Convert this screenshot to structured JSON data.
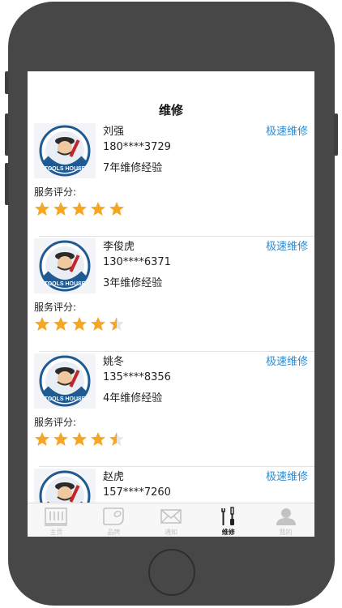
{
  "header": {
    "title": "维修"
  },
  "workers": [
    {
      "name": "刘强",
      "phone": "180****3729",
      "experience": "7年维修经验",
      "action": "极速维修",
      "rating_label": "服务评分:",
      "rating": 5
    },
    {
      "name": "李俊虎",
      "phone": "130****6371",
      "experience": "3年维修经验",
      "action": "极速维修",
      "rating_label": "服务评分:",
      "rating": 4.5
    },
    {
      "name": "姚冬",
      "phone": "135****8356",
      "experience": "4年维修经验",
      "action": "极速维修",
      "rating_label": "服务评分:",
      "rating": 4.5
    },
    {
      "name": "赵虎",
      "phone": "157****7260",
      "experience": "",
      "action": "极速维修",
      "rating_label": "",
      "rating": 0
    }
  ],
  "avatar_text": "TOOLS HOUSE",
  "tabs": [
    {
      "label": "主页",
      "icon": "home-grid-icon",
      "active": false
    },
    {
      "label": "品牌",
      "icon": "brand-tag-icon",
      "active": false
    },
    {
      "label": "通知",
      "icon": "mail-icon",
      "active": false
    },
    {
      "label": "维修",
      "icon": "wrench-screwdriver-icon",
      "active": true
    },
    {
      "label": "我的",
      "icon": "user-icon",
      "active": false
    }
  ],
  "colors": {
    "accent": "#2a8bd6",
    "star": "#f5a623",
    "star_empty": "#e6e6e6"
  }
}
